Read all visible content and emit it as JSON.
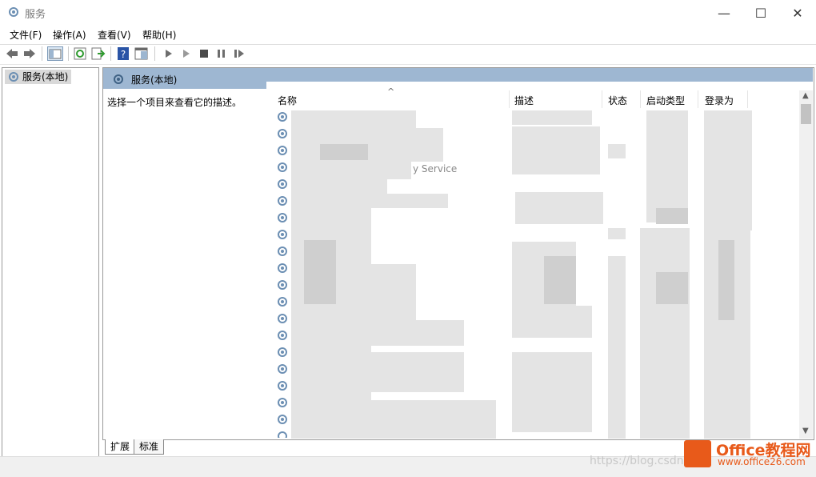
{
  "window": {
    "title": "服务"
  },
  "menu": [
    "文件(F)",
    "操作(A)",
    "查看(V)",
    "帮助(H)"
  ],
  "tree": {
    "item": "服务(本地)"
  },
  "panel": {
    "header": "服务(本地)",
    "description": "选择一个项目来查看它的描述。"
  },
  "columns": [
    "名称",
    "描述",
    "状态",
    "启动类型",
    "登录为"
  ],
  "visible_fragments": {
    "row4_name_tail": "y Service"
  },
  "tabs": [
    "扩展",
    "标准"
  ],
  "watermark": {
    "url": "https://blog.csdn",
    "logo_title": "Office教程网",
    "logo_url": "www.office26.com"
  },
  "colors": {
    "panel_header": "#9eb7d2",
    "logo_orange": "#e85a1a"
  }
}
